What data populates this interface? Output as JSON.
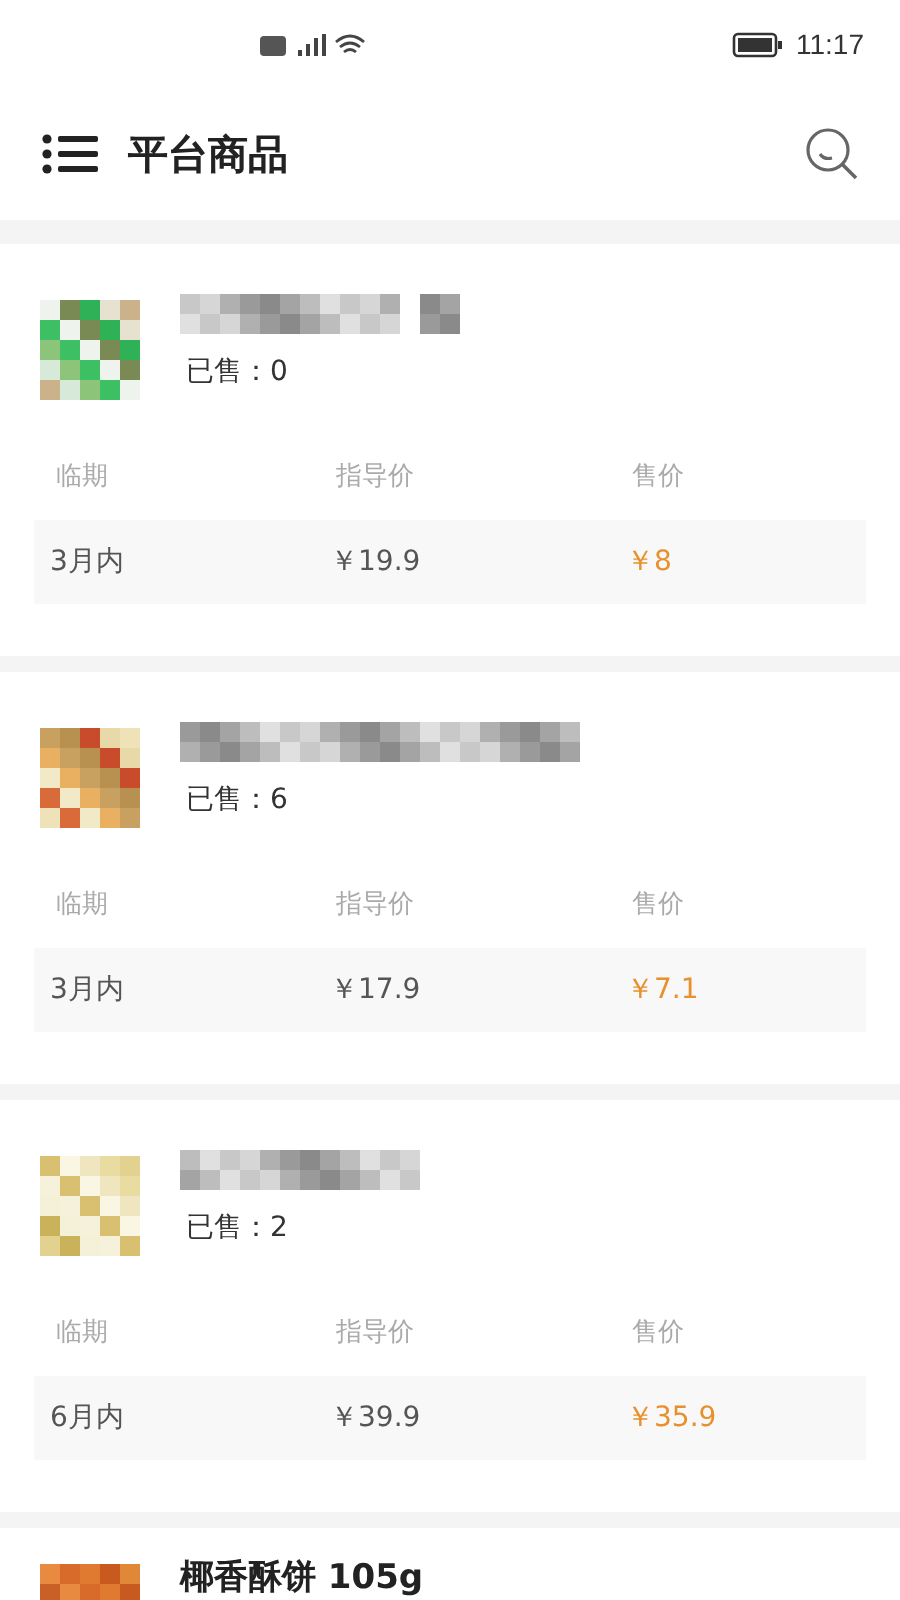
{
  "status_bar": {
    "time": "11:17"
  },
  "header": {
    "title": "平台商品"
  },
  "products": [
    {
      "sold_label": "已售：",
      "sold": "0",
      "columns": [
        "临期",
        "指导价",
        "售价"
      ],
      "expiry": "3月内",
      "guide_price": "￥19.9",
      "price": "￥8"
    },
    {
      "sold_label": "已售：",
      "sold": "6",
      "columns": [
        "临期",
        "指导价",
        "售价"
      ],
      "expiry": "3月内",
      "guide_price": "￥17.9",
      "price": "￥7.1"
    },
    {
      "sold_label": "已售：",
      "sold": "2",
      "columns": [
        "临期",
        "指导价",
        "售价"
      ],
      "expiry": "6月内",
      "guide_price": "￥39.9",
      "price": "￥35.9"
    },
    {
      "name": "椰香酥饼 105g"
    }
  ]
}
